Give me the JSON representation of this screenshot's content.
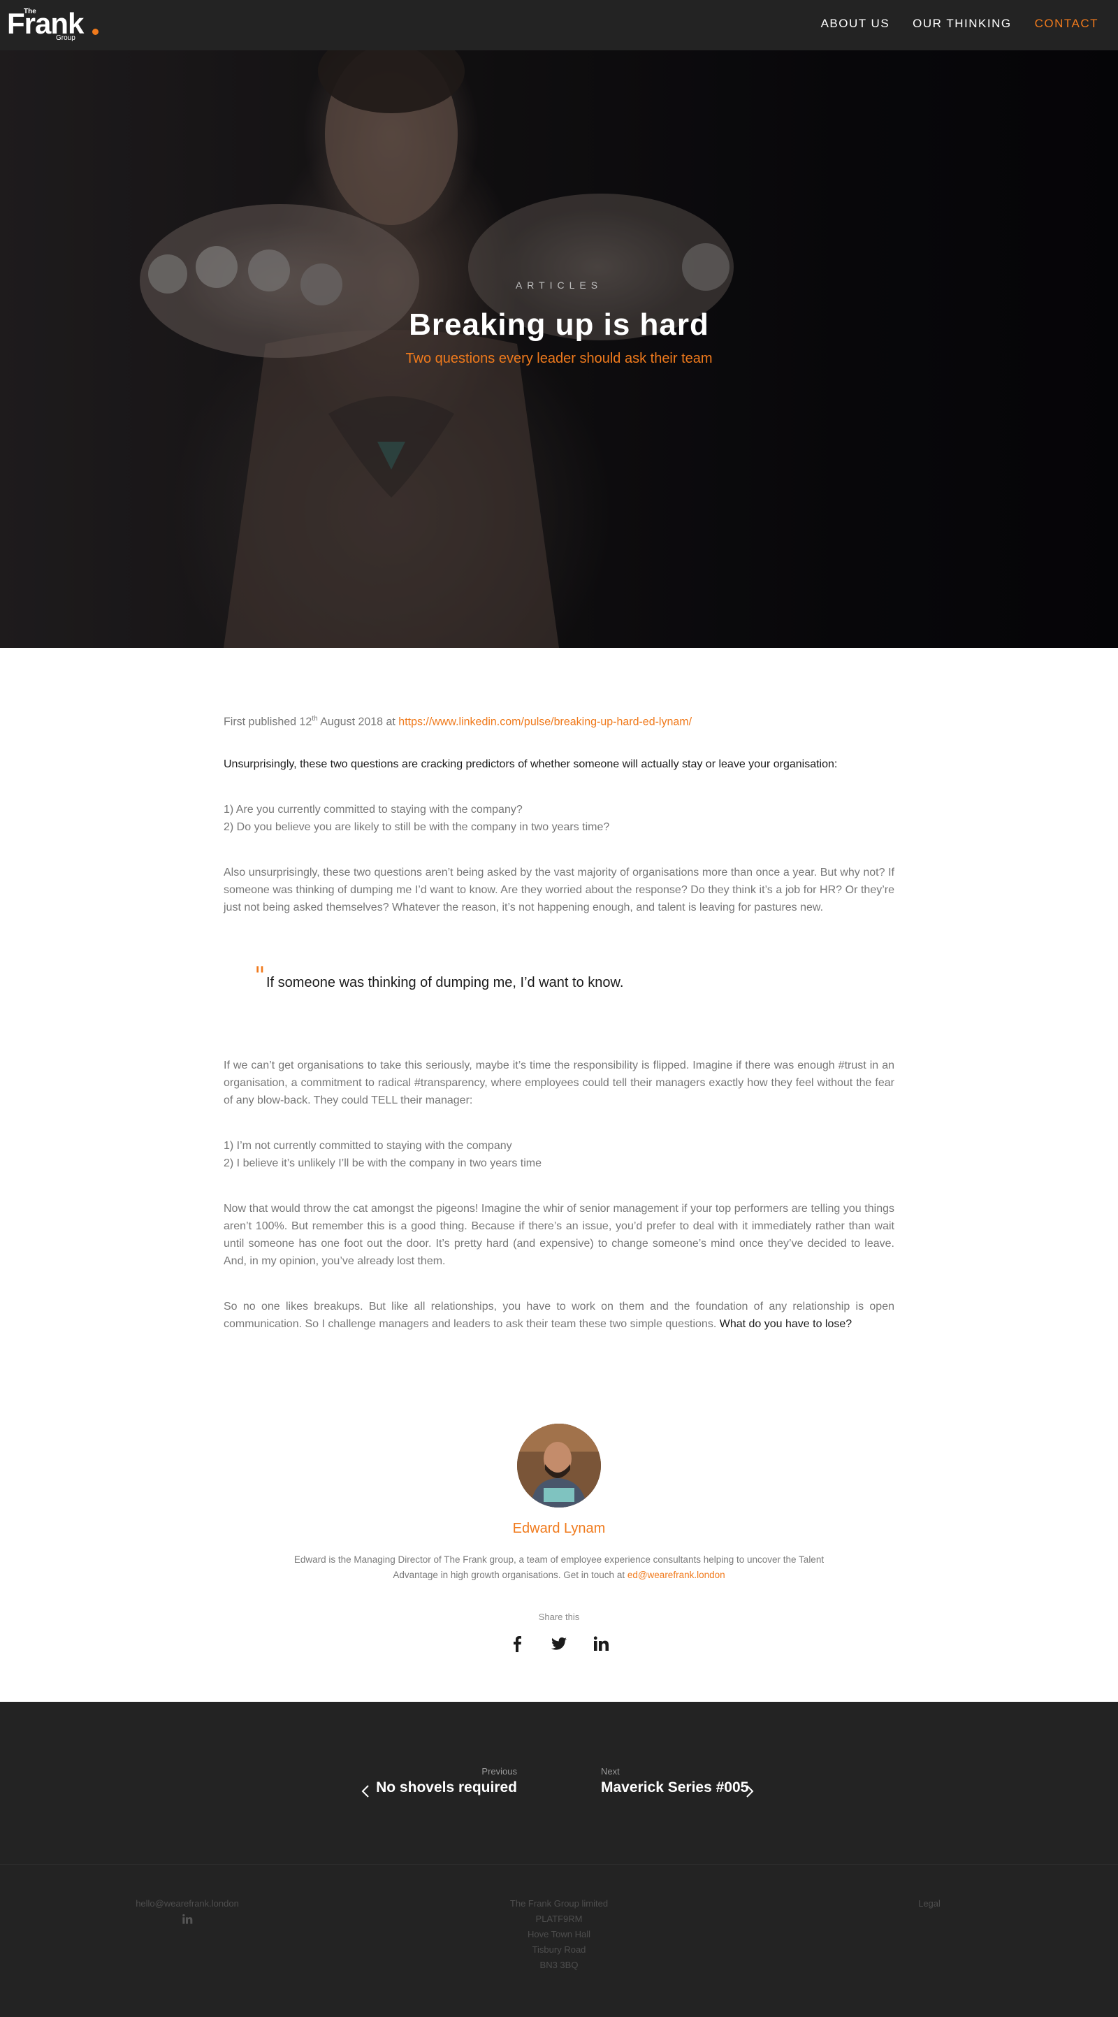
{
  "header": {
    "logo": {
      "the": "The",
      "name": "Frank",
      "group": "Group"
    },
    "nav": [
      "ABOUT US",
      "OUR THINKING",
      "CONTACT"
    ]
  },
  "hero": {
    "eyebrow": "ARTICLES",
    "title": "Breaking up is hard",
    "subtitle": "Two questions every leader should ask their team"
  },
  "article": {
    "published_prefix": "First published 12",
    "published_sup": "th",
    "published_mid": " August 2018 at ",
    "published_link": "https://www.linkedin.com/pulse/breaking-up-hard-ed-lynam/",
    "lead": "Unsurprisingly, these two questions are cracking predictors of whether someone will actually stay or leave your organisation:",
    "q1": "1) Are you currently committed to staying with the company?",
    "q2": "2) Do you believe you are likely to still be with the company in two years time?",
    "para1": "Also unsurprisingly, these two questions aren’t being asked by the vast majority of organisations more than once a year. But why not? If someone was thinking of dumping me I’d want to know. Are they worried about the response? Do they think it’s a job for HR? Or they’re just not being asked themselves? Whatever the reason, it’s not happening enough, and talent is leaving for pastures new.",
    "quote_mark": "\"",
    "quote": "If someone was thinking of dumping me, I’d want to know.",
    "para2": "If we can’t get organisations to take this seriously, maybe it’s time the responsibility is flipped. Imagine if there was enough #trust in an organisation, a commitment to radical #transparency, where employees could tell their managers exactly how they feel without the fear of any blow-back. They could TELL their manager:",
    "s1": "1) I’m not currently committed to staying with the company",
    "s2": "2) I believe it’s unlikely I’ll be with the company in two years time",
    "para3": "Now that would throw the cat amongst the pigeons! Imagine the whir of senior management if your top performers are telling you things aren’t 100%. But remember this is a good thing. Because if there’s an issue, you’d prefer to deal with it immediately rather than wait until someone has one foot out the door. It’s pretty hard (and expensive) to change someone’s mind once they’ve decided to leave. And, in my opinion, you’ve already lost them.",
    "para4": "So no one likes breakups. But like all relationships, you have to work on them and the foundation of any relationship is open communication. So I challenge managers and leaders to ask their team these two simple questions. ",
    "para4_strong": "What do you have to lose?"
  },
  "author": {
    "name": "Edward Lynam",
    "bio": "Edward is the Managing Director of The Frank group, a team of employee experience consultants helping to uncover the Talent Advantage in high growth organisations. Get in touch at ",
    "email": "ed@wearefrank.london"
  },
  "share": {
    "label": "Share this",
    "icons": [
      "facebook-icon",
      "twitter-icon",
      "linkedin-icon"
    ]
  },
  "postnav": {
    "prev_label": "Previous",
    "prev_title": "No shovels required",
    "next_label": "Next",
    "next_title": "Maverick Series #005"
  },
  "footer": {
    "email": "hello@wearefrank.london",
    "company": "The Frank Group limited",
    "address1": "PLATF9RM",
    "address2": "Hove Town Hall",
    "address3": "Tisbury Road",
    "address4": "BN3 3BQ",
    "legal": "Legal"
  },
  "colors": {
    "accent": "#f07a1c",
    "dark": "#232323",
    "text": "#777777"
  }
}
